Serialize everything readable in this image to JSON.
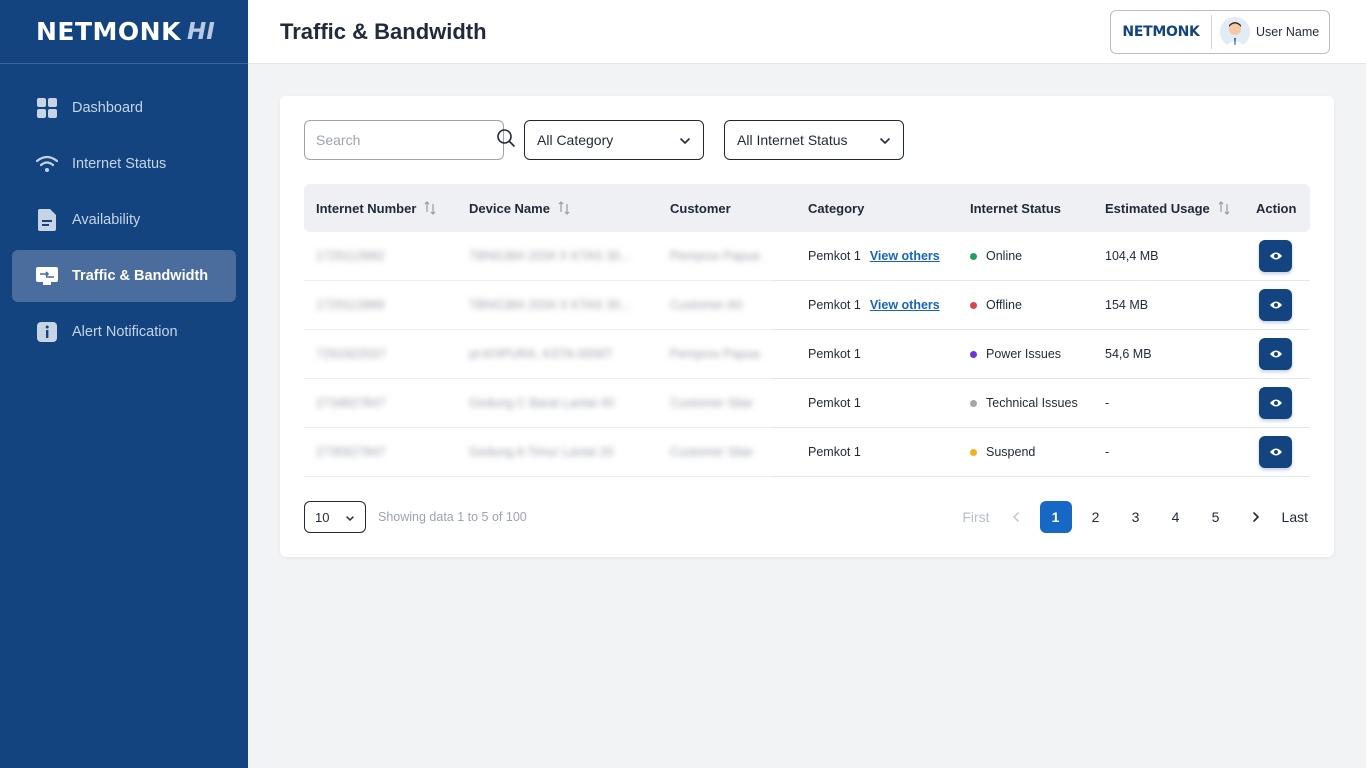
{
  "brand": {
    "name": "NETMONK",
    "tag": "HI"
  },
  "sidebar": {
    "items": [
      {
        "label": "Dashboard",
        "icon": "dashboard-icon",
        "active": false
      },
      {
        "label": "Internet Status",
        "icon": "wifi-icon",
        "active": false
      },
      {
        "label": "Availability",
        "icon": "document-icon",
        "active": false
      },
      {
        "label": "Traffic & Bandwidth",
        "icon": "traffic-icon",
        "active": true
      },
      {
        "label": "Alert Notification",
        "icon": "info-icon",
        "active": false
      }
    ]
  },
  "header": {
    "title": "Traffic & Bandwidth",
    "user_logo": "NETMONK",
    "user_name": "User Name"
  },
  "filters": {
    "search_placeholder": "Search",
    "category": "All Category",
    "status": "All Internet Status"
  },
  "table": {
    "columns": {
      "internet_number": "Internet Number",
      "device_name": "Device Name",
      "customer": "Customer",
      "category": "Category",
      "internet_status": "Internet Status",
      "estimated_usage": "Estimated Usage",
      "action": "Action"
    },
    "rows": [
      {
        "internet_number": "1729113982",
        "device_name": "TBNG384 2034 X KTAS 30...",
        "customer": "Pemprov Papua",
        "category": "Pemkot 1",
        "view_others": "View others",
        "status": "Online",
        "status_color": "#22a060",
        "usage": "104,4 MB"
      },
      {
        "internet_number": "1729113989",
        "device_name": "TBNG384 2034 X KTAS 30...",
        "customer": "Customer A0",
        "category": "Pemkot 1",
        "view_others": "View others",
        "status": "Offline",
        "status_color": "#e0414f",
        "usage": "154 MB"
      },
      {
        "internet_number": "7291922037",
        "device_name": "pt-KHPURA, KSTA 0006T",
        "customer": "Pemprov Papua",
        "category": "Pemkot 1",
        "view_others": "",
        "status": "Power Issues",
        "status_color": "#6b34d8",
        "usage": "54,6 MB"
      },
      {
        "internet_number": "2734827847",
        "device_name": "Gedung C Barat Lantai 40",
        "customer": "Customer Sitar",
        "category": "Pemkot 1",
        "view_others": "",
        "status": "Technical Issues",
        "status_color": "#a3a6ab",
        "usage": "-"
      },
      {
        "internet_number": "2735927847",
        "device_name": "Gedung A Timur Lantai 20",
        "customer": "Customer Sitar",
        "category": "Pemkot 1",
        "view_others": "",
        "status": "Suspend",
        "status_color": "#f2b01e",
        "usage": "-"
      }
    ]
  },
  "footer": {
    "per_page": "10",
    "showing": "Showing data 1 to 5 of 100",
    "first": "First",
    "last": "Last",
    "pages": [
      "1",
      "2",
      "3",
      "4",
      "5"
    ],
    "current_page": "1"
  },
  "colors": {
    "sidebar": "#134480",
    "accent": "#1768c4",
    "active_nav": "#4a6d9d"
  }
}
